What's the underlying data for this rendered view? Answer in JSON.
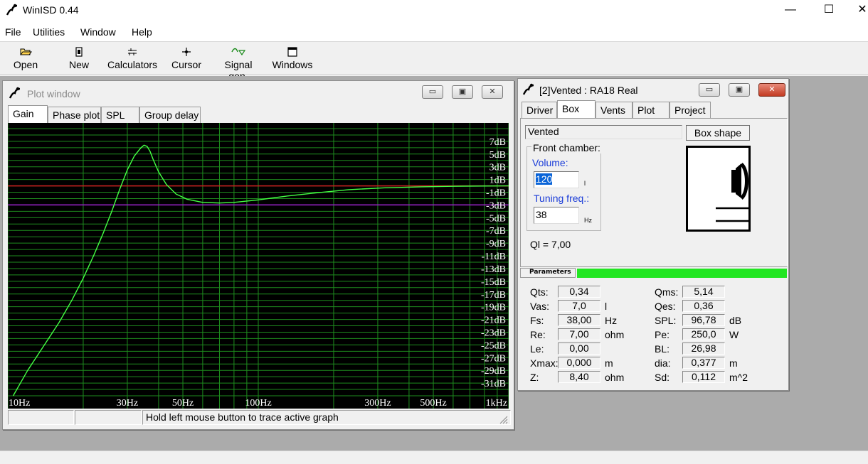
{
  "app": {
    "title": "WinISD 0.44",
    "controls": {
      "minimize": "—",
      "maximize": "☐",
      "close": "✕"
    }
  },
  "menu": [
    "File",
    "Utilities",
    "Window",
    "Help"
  ],
  "toolbar": [
    {
      "label": "Open",
      "icon": "folder-icon"
    },
    {
      "label": "New",
      "icon": "new-document-icon"
    },
    {
      "label": "Calculators",
      "icon": "calculator-icon"
    },
    {
      "label": "Cursor",
      "icon": "cursor-icon"
    },
    {
      "label": "Signal gen.",
      "icon": "signal-generator-icon"
    },
    {
      "label": "Windows",
      "icon": "windows-icon"
    }
  ],
  "plot_window": {
    "title": "Plot window",
    "tabs": [
      "Gain",
      "Phase plot",
      "SPL",
      "Group delay"
    ],
    "active_tab": "Gain",
    "status": [
      "",
      "",
      "Hold left mouse button to trace active graph"
    ]
  },
  "chart_data": {
    "type": "line",
    "xscale": "log",
    "xlim": [
      10,
      1000
    ],
    "ylim": [
      -33,
      9
    ],
    "x_tick_labels": [
      {
        "v": 10,
        "t": "10Hz"
      },
      {
        "v": 30,
        "t": "30Hz"
      },
      {
        "v": 50,
        "t": "50Hz"
      },
      {
        "v": 100,
        "t": "100Hz"
      },
      {
        "v": 300,
        "t": "300Hz"
      },
      {
        "v": 500,
        "t": "500Hz"
      },
      {
        "v": 1000,
        "t": "1kHz"
      }
    ],
    "y_tick_labels": [
      "7dB",
      "5dB",
      "3dB",
      "1dB",
      "-1dB",
      "-3dB",
      "-5dB",
      "-7dB",
      "-9dB",
      "-11dB",
      "-13dB",
      "-15dB",
      "-17dB",
      "-19dB",
      "-21dB",
      "-23dB",
      "-25dB",
      "-27dB",
      "-29dB",
      "-31dB"
    ],
    "y_tick_values": [
      7,
      5,
      3,
      1,
      -1,
      -3,
      -5,
      -7,
      -9,
      -11,
      -13,
      -15,
      -17,
      -19,
      -21,
      -23,
      -25,
      -27,
      -29,
      -31
    ],
    "reference_lines": [
      {
        "y": 0,
        "color": "#d02020"
      },
      {
        "y": -3,
        "color": "#a020d0"
      }
    ],
    "series": [
      {
        "color": "#44ff44",
        "x": [
          10.5,
          12,
          14,
          16,
          18,
          20,
          22,
          24,
          26,
          28,
          30,
          32,
          34,
          35,
          36,
          37,
          38,
          40,
          43,
          47,
          52,
          60,
          70,
          80,
          100,
          130,
          170,
          230,
          320,
          450,
          650,
          1000
        ],
        "y": [
          -33,
          -29,
          -25,
          -21.5,
          -18,
          -14.5,
          -11,
          -7.5,
          -4,
          -0.5,
          2.5,
          4.7,
          6,
          6.4,
          6.2,
          5.4,
          4.2,
          2.2,
          0.2,
          -1.3,
          -2.1,
          -2.6,
          -2.7,
          -2.6,
          -2.2,
          -1.6,
          -1.1,
          -0.6,
          -0.3,
          -0.15,
          -0.05,
          0
        ]
      }
    ],
    "grid": true,
    "background": "#000000",
    "grid_color": "#1e8c1e"
  },
  "box_window": {
    "title": "[2]Vented : RA18 Real",
    "tabs": [
      "Driver",
      "Box",
      "Vents",
      "Plot",
      "Project"
    ],
    "active_tab": "Box",
    "box_type": "Vented",
    "box_shape_button": "Box shape",
    "front_chamber_label": "Front chamber:",
    "volume_label": "Volume:",
    "volume_value": "120",
    "volume_unit": "l",
    "tuning_label": "Tuning freq.:",
    "tuning_value": "38",
    "tuning_unit": "Hz",
    "ql": "Ql = 7,00",
    "parameters_tab": "Parameters",
    "accent_color": "#22e622",
    "params_left": [
      {
        "label": "Qts:",
        "value": "0,34",
        "unit": ""
      },
      {
        "label": "Vas:",
        "value": "7,0",
        "unit": "l"
      },
      {
        "label": "Fs:",
        "value": "38,00",
        "unit": "Hz"
      },
      {
        "label": "Re:",
        "value": "7,00",
        "unit": "ohm"
      },
      {
        "label": "Le:",
        "value": "0,00",
        "unit": ""
      },
      {
        "label": "Xmax:",
        "value": "0,000",
        "unit": "m"
      },
      {
        "label": "Z:",
        "value": "8,40",
        "unit": "ohm"
      }
    ],
    "params_right": [
      {
        "label": "Qms:",
        "value": "5,14",
        "unit": ""
      },
      {
        "label": "Qes:",
        "value": "0,36",
        "unit": ""
      },
      {
        "label": "SPL:",
        "value": "96,78",
        "unit": "dB"
      },
      {
        "label": "Pe:",
        "value": "250,0",
        "unit": "W"
      },
      {
        "label": "BL:",
        "value": "26,98",
        "unit": ""
      },
      {
        "label": "dia:",
        "value": "0,377",
        "unit": "m"
      },
      {
        "label": "Sd:",
        "value": "0,112",
        "unit": "m^2"
      }
    ]
  }
}
